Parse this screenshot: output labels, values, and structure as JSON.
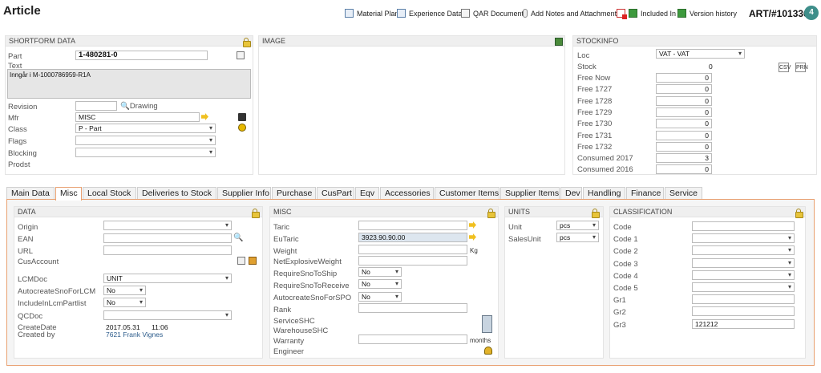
{
  "page": {
    "title": "Article",
    "article_number": "ART/#101336",
    "badge_count": "4"
  },
  "toolbar": [
    {
      "label": "Material Plan",
      "icon": "grid-icon"
    },
    {
      "label": "Experience Data",
      "icon": "window-icon"
    },
    {
      "label": "QAR Documents",
      "icon": "document-icon"
    },
    {
      "label": "Add Notes and Attachments",
      "icon": "paperclip-icon"
    },
    {
      "label": "",
      "icon": "pdf-icon"
    },
    {
      "label": "Included In",
      "icon": "refresh-icon"
    },
    {
      "label": "Version history",
      "icon": "history-icon"
    }
  ],
  "shortform": {
    "header": "SHORTFORM DATA",
    "part_label": "Part",
    "part_value": "1-480281-0",
    "text_label": "Text",
    "text_value": "Inngår i M-1000786959-R1A",
    "revision_label": "Revision",
    "revision_value": "",
    "drawing_label": "Drawing",
    "mfr_label": "Mfr",
    "mfr_value": "MISC",
    "class_label": "Class",
    "class_value": "P - Part",
    "flags_label": "Flags",
    "flags_value": "",
    "blocking_label": "Blocking",
    "blocking_value": "",
    "prodst_label": "Prodst"
  },
  "image": {
    "header": "IMAGE"
  },
  "stockinfo": {
    "header": "STOCKINFO",
    "loc_label": "Loc",
    "loc_value": "VAT - VAT",
    "stock_label": "Stock",
    "stock_value": "0",
    "rows": [
      {
        "label": "Free Now",
        "value": "0"
      },
      {
        "label": "Free 1727",
        "value": "0"
      },
      {
        "label": "Free 1728",
        "value": "0"
      },
      {
        "label": "Free 1729",
        "value": "0"
      },
      {
        "label": "Free 1730",
        "value": "0"
      },
      {
        "label": "Free 1731",
        "value": "0"
      },
      {
        "label": "Free 1732",
        "value": "0"
      },
      {
        "label": "Consumed 2017",
        "value": "3"
      },
      {
        "label": "Consumed 2016",
        "value": "0"
      }
    ],
    "icon1_label": "CSV",
    "icon2_label": "PRN"
  },
  "tabs": [
    "Main Data",
    "Misc",
    "Local Stock",
    "Deliveries to Stock",
    "Supplier Info",
    "Purchase",
    "CusPart",
    "Eqv",
    "Accessories",
    "Customer Items",
    "Supplier Items",
    "Dev",
    "Handling",
    "Finance",
    "Service"
  ],
  "active_tab": "Misc",
  "data_panel": {
    "header": "DATA",
    "origin_label": "Origin",
    "origin_value": "",
    "ean_label": "EAN",
    "ean_value": "",
    "url_label": "URL",
    "url_value": "",
    "cusaccount_label": "CusAccount",
    "lcmdoc_label": "LCMDoc",
    "lcmdoc_value": "UNIT",
    "autocreate_lcm_label": "AutocreateSnoForLCM",
    "autocreate_lcm_value": "No",
    "include_lcm_label": "IncludeInLcmPartlist",
    "include_lcm_value": "No",
    "qcdoc_label": "QCDoc",
    "qcdoc_value": "",
    "createdate_label": "CreateDate",
    "createdate_value": "2017.05.31",
    "createtime_value": "11:06",
    "createdby_label": "Created by",
    "createdby_value": "7621 Frank Vignes"
  },
  "misc_panel": {
    "header": "MISC",
    "taric_label": "Taric",
    "taric_value": "",
    "eutaric_label": "EuTaric",
    "eutaric_value": "3923.90.90.00",
    "weight_label": "Weight",
    "weight_value": "",
    "weight_unit": "Kg",
    "netexpl_label": "NetExplosiveWeight",
    "netexpl_value": "",
    "reqship_label": "RequireSnoToShip",
    "reqship_value": "No",
    "reqrecv_label": "RequireSnoToReceive",
    "reqrecv_value": "No",
    "autospo_label": "AutocreateSnoForSPO",
    "autospo_value": "No",
    "rank_label": "Rank",
    "rank_value": "",
    "serviceshc_label": "ServiceSHC",
    "warehouseshc_label": "WarehouseSHC",
    "warranty_label": "Warranty",
    "warranty_value": "",
    "warranty_unit": "months",
    "engineer_label": "Engineer"
  },
  "units_panel": {
    "header": "UNITS",
    "unit_label": "Unit",
    "unit_value": "pcs",
    "salesunit_label": "SalesUnit",
    "salesunit_value": "pcs"
  },
  "classification_panel": {
    "header": "CLASSIFICATION",
    "rows": [
      {
        "label": "Code",
        "value": ""
      },
      {
        "label": "Code 1",
        "value": ""
      },
      {
        "label": "Code 2",
        "value": ""
      },
      {
        "label": "Code 3",
        "value": ""
      },
      {
        "label": "Code 4",
        "value": ""
      },
      {
        "label": "Code 5",
        "value": ""
      },
      {
        "label": "Gr1",
        "value": ""
      },
      {
        "label": "Gr2",
        "value": ""
      },
      {
        "label": "Gr3",
        "value": "121212"
      }
    ]
  }
}
